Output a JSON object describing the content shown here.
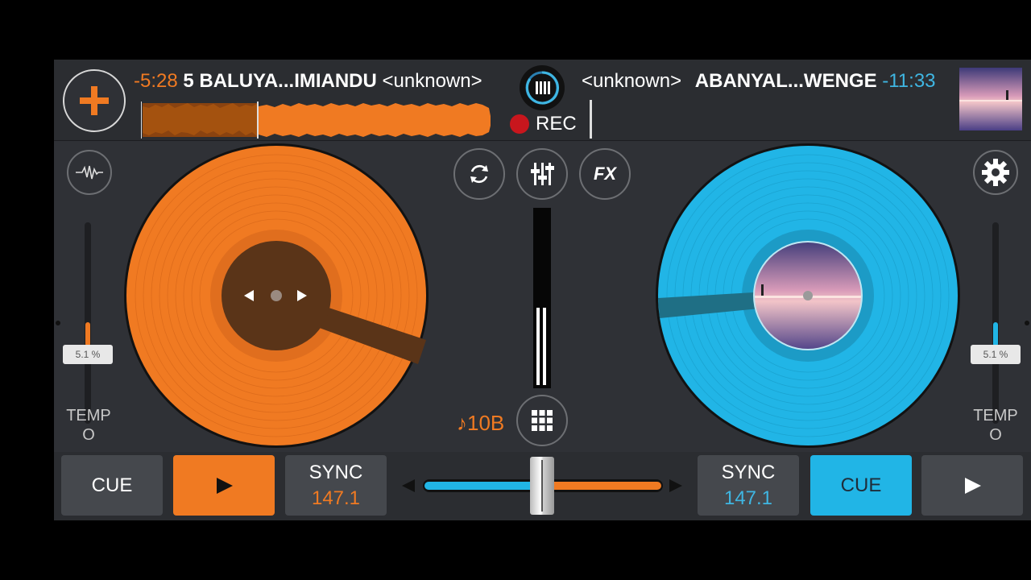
{
  "deck_left": {
    "time_remaining": "-5:28",
    "track_title": "5 BALUYA...IMIANDU",
    "artist": "<unknown>",
    "tempo_percent": "5.1 %",
    "tempo_label": "TEMPO",
    "sync_label": "SYNC",
    "bpm": "147.1",
    "cue_label": "CUE",
    "key": "♪10B",
    "color": "#f07a22"
  },
  "deck_right": {
    "time_remaining": "-11:33",
    "track_title": "ABANYAL...WENGE",
    "artist": "<unknown>",
    "tempo_percent": "5.1 %",
    "tempo_label": "TEMPO",
    "sync_label": "SYNC",
    "bpm": "147.1",
    "cue_label": "CUE",
    "color": "#21b5e6"
  },
  "recorder": {
    "label": "REC"
  },
  "mixer": {
    "fx_label": "FX",
    "crossfader_position": 0.5
  },
  "icons": {
    "add": "plus-icon",
    "waveform": "waveform-icon",
    "loop": "sync-loop-icon",
    "eq": "equalizer-icon",
    "settings": "gear-icon",
    "grid": "grid-icon",
    "play": "play-icon"
  }
}
